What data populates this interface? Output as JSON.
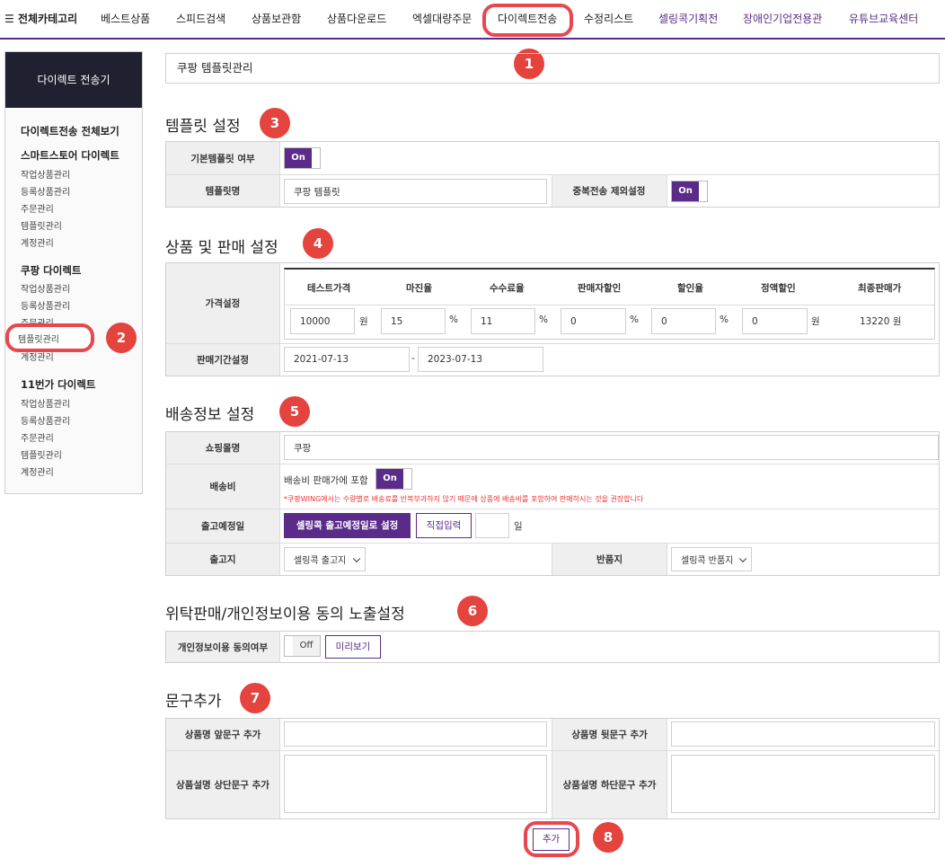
{
  "topnav": {
    "all_categories": "전체카테고리",
    "items": [
      "베스트상품",
      "스피드검색",
      "상품보관함",
      "상품다운로드",
      "엑셀대량주문",
      "다이렉트전송",
      "수정리스트",
      "셀링콕기획전",
      "장애인기업전용관",
      "유튜브교육센터"
    ]
  },
  "badges": [
    "1",
    "2",
    "3",
    "4",
    "5",
    "6",
    "7",
    "8"
  ],
  "sidebar": {
    "title": "다이렉트 전송기",
    "view_all": "다이렉트전송 전체보기",
    "groups": [
      {
        "title": "스마트스토어 다이렉트",
        "items": [
          "작업상품관리",
          "등록상품관리",
          "주문관리",
          "템플릿관리",
          "계정관리"
        ]
      },
      {
        "title": "쿠팡 다이렉트",
        "items": [
          "작업상품관리",
          "등록상품관리",
          "주문관리",
          "템플릿관리",
          "계정관리"
        ]
      },
      {
        "title": "11번가 다이렉트",
        "items": [
          "작업상품관리",
          "등록상품관리",
          "주문관리",
          "템플릿관리",
          "계정관리"
        ]
      }
    ]
  },
  "page_title": "쿠팡 템플릿관리",
  "template": {
    "heading": "템플릿 설정",
    "default_label": "기본템플릿 여부",
    "default_toggle": "On",
    "name_label": "템플릿명",
    "name_value": "쿠팡 템플릿",
    "dup_label": "중복전송 제외설정",
    "dup_toggle": "On"
  },
  "product": {
    "heading": "상품 및 판매 설정",
    "price_label": "가격설정",
    "columns": [
      "테스트가격",
      "마진율",
      "수수료율",
      "판매자할인",
      "할인율",
      "정액할인",
      "최종판매가"
    ],
    "values": [
      "10000",
      "15",
      "11",
      "0",
      "0",
      "0"
    ],
    "units": [
      "원",
      "%",
      "%",
      "%",
      "%",
      "원"
    ],
    "final_price": "13220 원",
    "period_label": "판매기간설정",
    "start_date": "2021-07-13",
    "end_date": "2023-07-13",
    "period_sep": "-"
  },
  "shipping": {
    "heading": "배송정보 설정",
    "mall_label": "쇼핑몰명",
    "mall_value": "쿠팡",
    "fee_label": "배송비",
    "fee_text": "배송비 판매가에 포함",
    "fee_toggle": "On",
    "fee_note": "*쿠팡WING에서는 수량별로 배송료를 반복부과하지 않기 때문에 상품에 배송비를 포함하여 판매하시는 것을 권장합니다",
    "ship_date_label": "출고예정일",
    "ship_date_btn": "셀링콕 출고예정일로 설정",
    "direct_btn": "직접입력",
    "day_unit": "일",
    "origin_label": "출고지",
    "origin_value": "셀링콕 출고지",
    "return_label": "반품지",
    "return_value": "셀링콕 반품지"
  },
  "consent": {
    "heading": "위탁판매/개인정보이용 동의 노출설정",
    "label": "개인정보이용 동의여부",
    "toggle": "Off",
    "preview_btn": "미리보기"
  },
  "phrases": {
    "heading": "문구추가",
    "name_front": "상품명 앞문구 추가",
    "name_back": "상품명 뒷문구 추가",
    "desc_top": "상품설명 상단문구 추가",
    "desc_bottom": "상품설명 하단문구 추가"
  },
  "add_button": "추가"
}
